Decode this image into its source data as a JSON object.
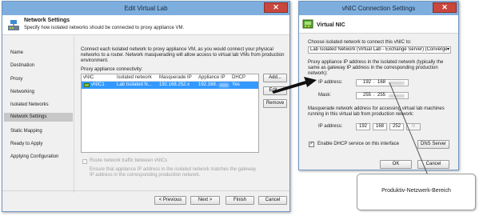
{
  "left_dialog": {
    "title": "Edit Virtual Lab",
    "header_title": "Network Settings",
    "header_subtitle": "Specify how isolated networks should be connected to proxy appliance VM.",
    "nav_items": [
      "Name",
      "Destination",
      "Proxy",
      "Networking",
      "Isolated Networks",
      "Network Settings",
      "Static Mapping",
      "Ready to Apply",
      "Applying Configuration"
    ],
    "selected_nav": "Network Settings",
    "description": "Connect each isolated network to proxy appliance VM, as you would connect your physical networks to a router. Network masquerading will allow access to virtual lab VMs from production environment.",
    "connectivity_label": "Proxy appliance connectivity:",
    "table": {
      "columns": [
        "vNIC",
        "Isolated network",
        "Masquerade IP",
        "Appliance IP",
        "DHCP"
      ],
      "rows": [
        {
          "vnic": "vNIC1",
          "network": "Lab Isolated N...",
          "masquerade_ip": "192.168.252.x",
          "appliance_ip": "192.168.",
          "dhcp": "Yes"
        }
      ]
    },
    "buttons": {
      "add": "Add...",
      "edit": "Edit...",
      "remove": "Remove"
    },
    "route_checkbox_label": "Route network traffic between vNICs",
    "route_note": "Ensure that appliance IP address in the isolated network matches the gateway IP address in the corresponding production network.",
    "footer": {
      "previous": "< Previous",
      "next": "Next >",
      "finish": "Finish",
      "cancel": "Cancel"
    }
  },
  "right_dialog": {
    "title": "vNIC Connection Settings",
    "header_title": "Virtual NIC",
    "choose_label": "Choose isolated network to connect this vNIC to:",
    "network_select_value": "Lab Isolated Network (Virtual Lab - Exchange Server) (Converge",
    "appliance_desc": "Proxy appliance IP address in the isolated network (typically the same as gateway IP address in the corresponding production network):",
    "ip_label": "IP address:",
    "ip_octets": [
      "192",
      "168"
    ],
    "mask_label": "Mask:",
    "mask_octets": [
      "255",
      "255"
    ],
    "masquerade_desc": "Masquerade network address for accessing virtual lab machines running in this virtual lab from production network:",
    "masq_ip_label": "IP address:",
    "masq_octets": [
      "192",
      "168",
      "252",
      "0"
    ],
    "dhcp_label": "Enable DHCP service on this interface",
    "dns_button": "DNS Server",
    "ok": "OK",
    "cancel": "Cancel"
  },
  "callout": {
    "text": "Produktiv-Netzwerk-Bereich"
  },
  "colors": {
    "titlebar": "#7eaedd",
    "close": "#c9473d",
    "selection": "#3399ff",
    "nav_selected": "#c7c7c7",
    "accent_arrow": "#111111"
  }
}
